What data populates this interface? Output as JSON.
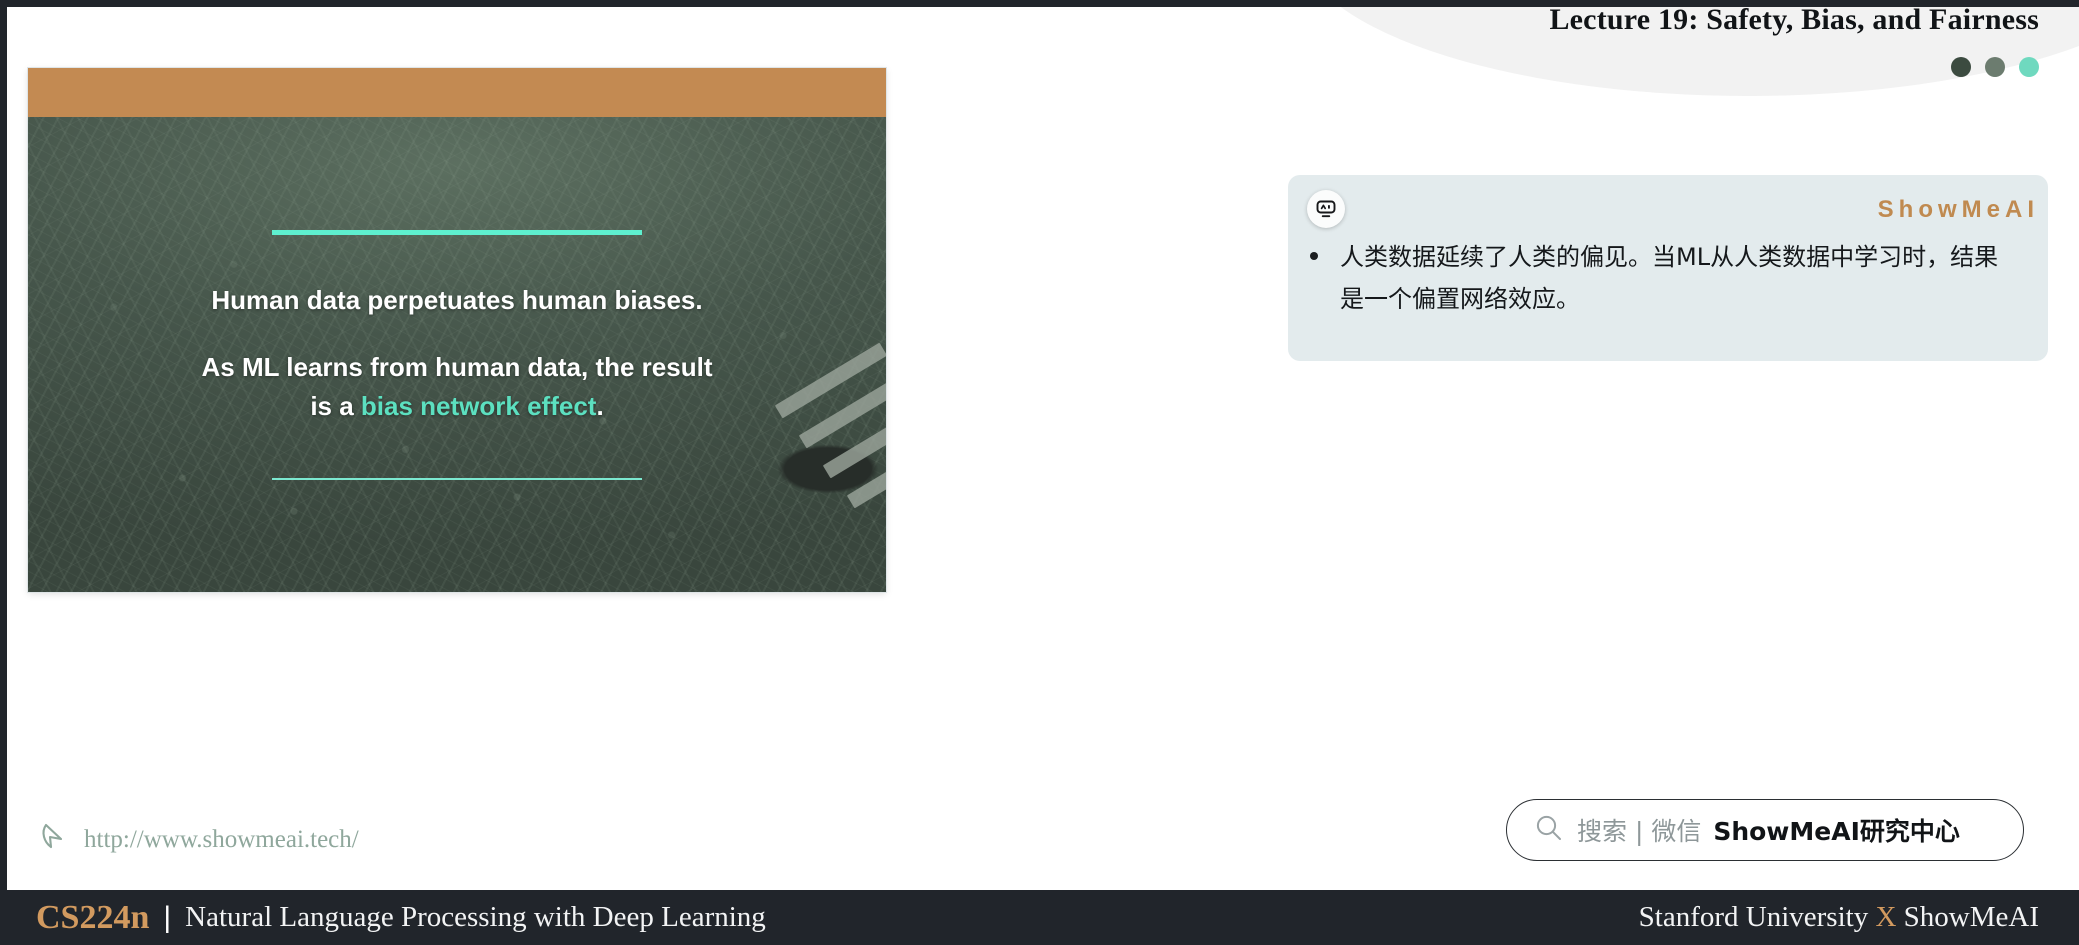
{
  "header": {
    "title": "Lecture 19: Safety, Bias, and Fairness",
    "dots": [
      {
        "name": "dot-dark",
        "color": "#3c4b40"
      },
      {
        "name": "dot-medium",
        "color": "#6c7c6f"
      },
      {
        "name": "dot-light",
        "color": "#6fd9bf"
      }
    ]
  },
  "slide": {
    "top_bar_color": "#c38a52",
    "accent_color": "#5ce0c0",
    "line1": "Human data perpetuates human biases.",
    "line2_part1": "As ML learns from human data, the result",
    "line2_part2": "is a ",
    "line2_accent": "bias network effect",
    "line2_part3": "."
  },
  "footer": {
    "url": "http://www.showmeai.tech/",
    "cursor_icon": "cursor-pointer-icon"
  },
  "panel": {
    "badge_icon": "ai-robot-face-icon",
    "brand": "ShowMeAI",
    "brand_color": "#c08a50",
    "bullet": "人类数据延续了人类的偏见。当ML从人类数据中学习时，结果是一个偏置网络效应。"
  },
  "search": {
    "icon": "search-icon",
    "label": "搜索 | 微信",
    "strong": "ShowMeAI研究中心"
  },
  "bottom": {
    "course": "CS224n",
    "separator": "|",
    "subtitle": "Natural Language Processing with Deep Learning",
    "org_prefix": "Stanford University ",
    "org_x": "X",
    "org_suffix": " ShowMeAI",
    "accent_color": "#d29a5f"
  }
}
